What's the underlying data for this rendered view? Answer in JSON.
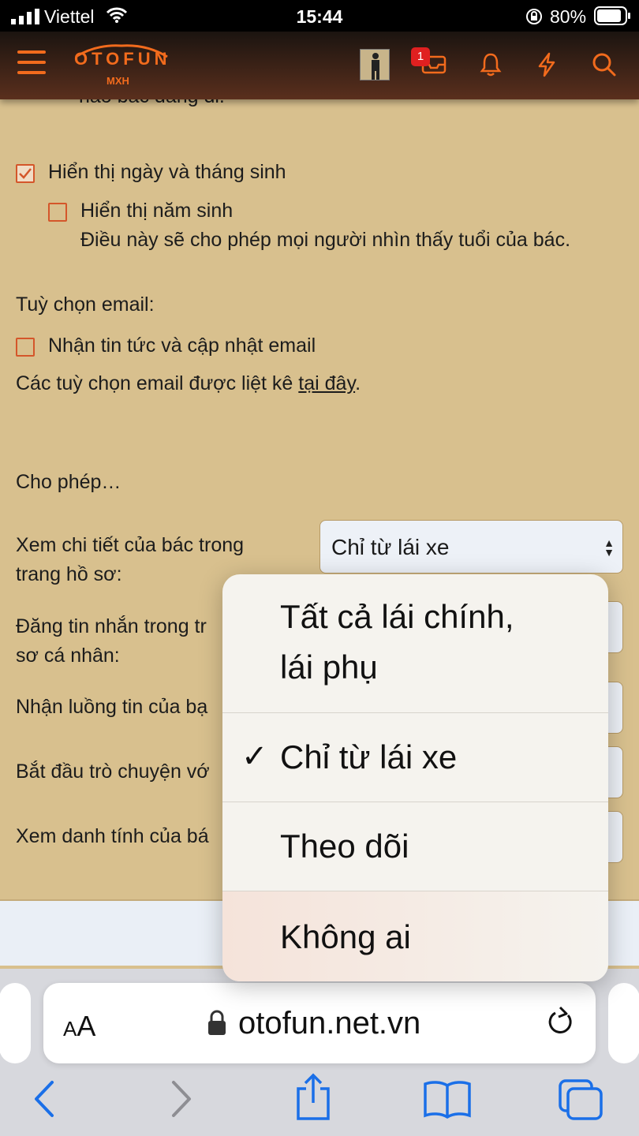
{
  "status_bar": {
    "carrier": "Viettel",
    "time": "15:44",
    "battery": "80%"
  },
  "header": {
    "logo_text": "OTOFUN",
    "logo_sub": "MXH",
    "notification_count": "1"
  },
  "content": {
    "partial_text": "nào bác đang đi.",
    "show_birthday_label": "Hiển thị ngày và tháng sinh",
    "show_birth_year_label": "Hiển thị năm sinh",
    "show_birth_year_help": "Điều này sẽ cho phép mọi người nhìn thấy tuổi của bác.",
    "email_options_heading": "Tuỳ chọn email:",
    "email_news_label": "Nhận tin tức và cập nhật email",
    "email_list_text": "Các tuỳ chọn email được liệt kê",
    "email_link": "tại đây",
    "allow_heading": "Cho phép…",
    "rows": [
      {
        "label_line1": "Xem chi tiết của bác trong",
        "label_line2": "trang hồ sơ:",
        "value": "Chỉ từ lái xe"
      },
      {
        "label_line1": "Đăng tin nhắn trong tr",
        "label_line2": "sơ cá nhân:"
      },
      {
        "label_line1": "Nhận luồng tin của bạ"
      },
      {
        "label_line1": "Bắt đầu trò chuyện vớ"
      },
      {
        "label_line1": "Xem danh tính của bá"
      }
    ]
  },
  "dropdown": {
    "options": [
      {
        "line1": "Tất cả lái chính,",
        "line2": "lái phụ",
        "selected": false
      },
      {
        "line1": "Chỉ từ lái xe",
        "selected": true
      },
      {
        "line1": "Theo dõi",
        "selected": false
      },
      {
        "line1": "Không ai",
        "selected": false
      }
    ],
    "check_glyph": "✓"
  },
  "browser": {
    "aa_small": "A",
    "aa_big": "A",
    "url": "otofun.net.vn"
  },
  "colors": {
    "accent": "#f26b1d",
    "checkbox": "#d4562a",
    "ios_blue": "#1a6fe8"
  }
}
